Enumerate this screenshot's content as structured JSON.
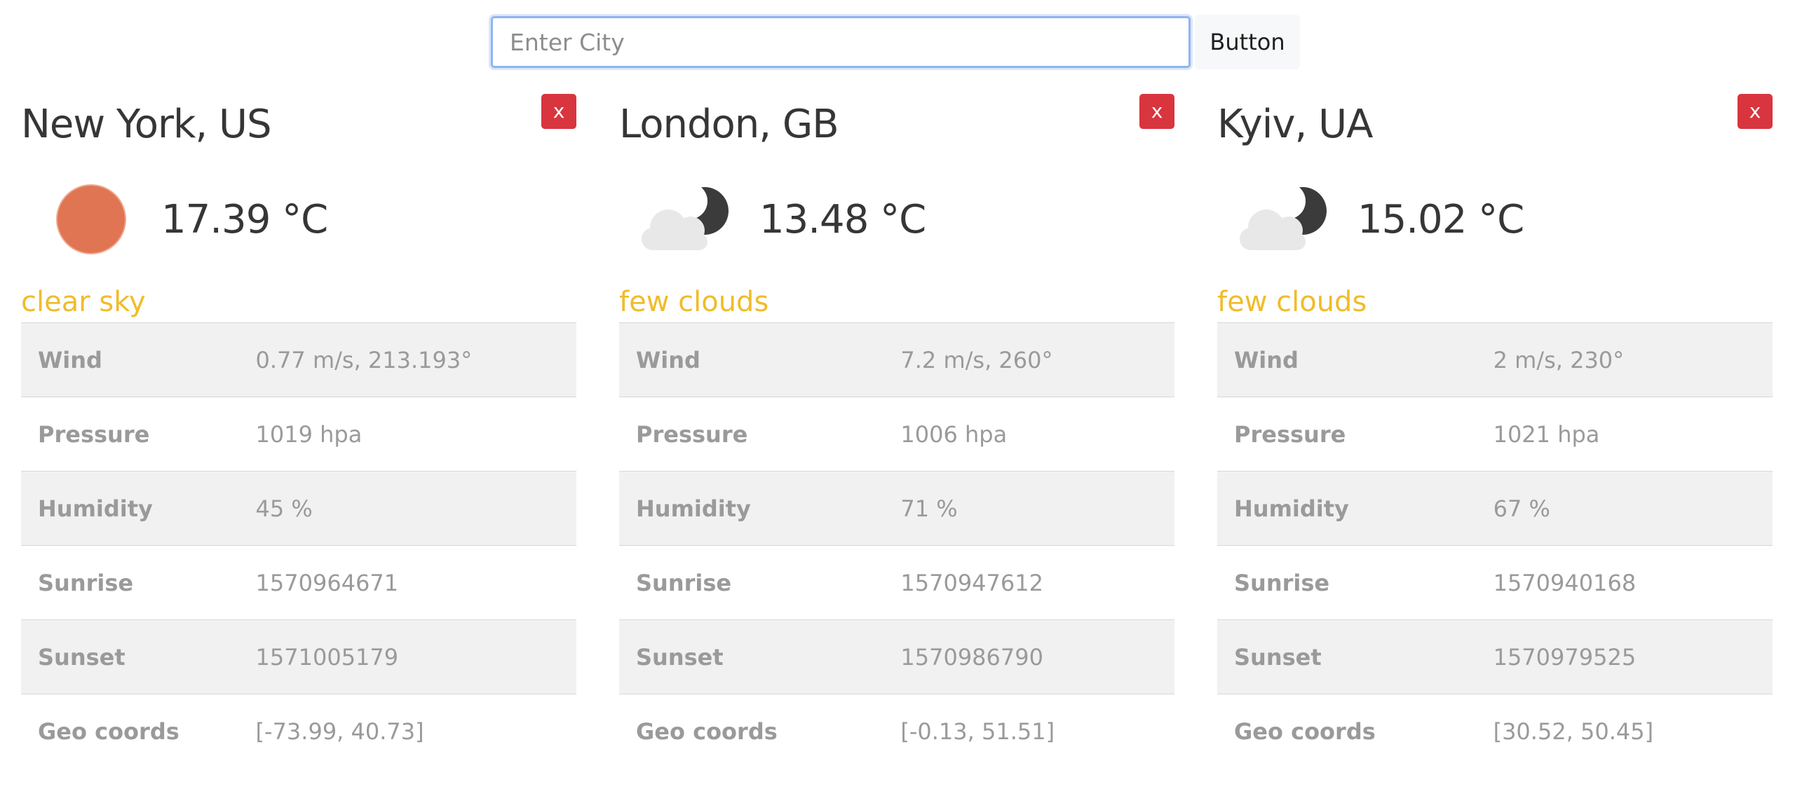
{
  "search": {
    "placeholder": "Enter City",
    "button_label": "Button"
  },
  "cards": [
    {
      "city": "New York, US",
      "remove_label": "x",
      "icon": "sun-icon",
      "temperature": "17.39 °C",
      "description": "clear sky",
      "details": [
        {
          "label": "Wind",
          "value": "0.77 m/s, 213.193°"
        },
        {
          "label": "Pressure",
          "value": "1019 hpa"
        },
        {
          "label": "Humidity",
          "value": "45 %"
        },
        {
          "label": "Sunrise",
          "value": "1570964671"
        },
        {
          "label": "Sunset",
          "value": "1571005179"
        },
        {
          "label": "Geo coords",
          "value": "[-73.99, 40.73]"
        }
      ]
    },
    {
      "city": "London, GB",
      "remove_label": "x",
      "icon": "moon-cloud-icon",
      "temperature": "13.48 °C",
      "description": "few clouds",
      "details": [
        {
          "label": "Wind",
          "value": "7.2 m/s, 260°"
        },
        {
          "label": "Pressure",
          "value": "1006 hpa"
        },
        {
          "label": "Humidity",
          "value": "71 %"
        },
        {
          "label": "Sunrise",
          "value": "1570947612"
        },
        {
          "label": "Sunset",
          "value": "1570986790"
        },
        {
          "label": "Geo coords",
          "value": "[-0.13, 51.51]"
        }
      ]
    },
    {
      "city": "Kyiv, UA",
      "remove_label": "x",
      "icon": "moon-cloud-icon",
      "temperature": "15.02 °C",
      "description": "few clouds",
      "details": [
        {
          "label": "Wind",
          "value": "2 m/s, 230°"
        },
        {
          "label": "Pressure",
          "value": "1021 hpa"
        },
        {
          "label": "Humidity",
          "value": "67 %"
        },
        {
          "label": "Sunrise",
          "value": "1570940168"
        },
        {
          "label": "Sunset",
          "value": "1570979525"
        },
        {
          "label": "Geo coords",
          "value": "[30.52, 50.45]"
        }
      ]
    }
  ],
  "colors": {
    "description": "#f0bc2a",
    "remove_button": "#d8353f",
    "sun": "#e07553"
  }
}
